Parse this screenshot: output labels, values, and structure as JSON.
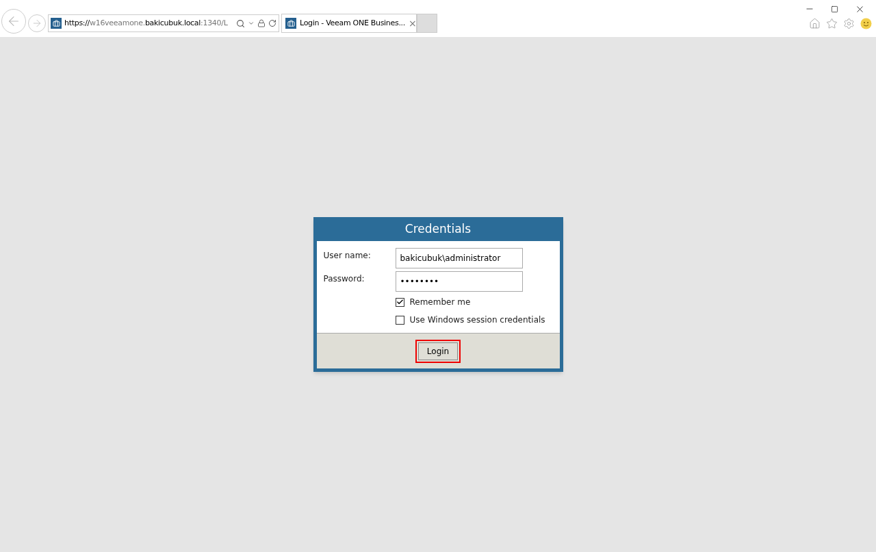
{
  "browser": {
    "address": {
      "scheme": "https://",
      "subdomain": "w16veeamone.",
      "domain": "bakicubuk.local",
      "rest": ":1340/L"
    },
    "tabs": [
      {
        "label": "Login - Veeam ONE Busines...",
        "close": "×",
        "selected": true
      }
    ]
  },
  "dialog": {
    "title": "Credentials",
    "fields": [
      {
        "label": "User name:",
        "value": "bakicubuk\\administrator"
      },
      {
        "label": "Password:",
        "value": "••••••••"
      }
    ],
    "options": [
      {
        "label": "Remember me",
        "checked": true
      },
      {
        "label": "Use Windows session credentials",
        "checked": false
      }
    ],
    "button": {
      "label": "Login",
      "highlighted": true
    }
  }
}
